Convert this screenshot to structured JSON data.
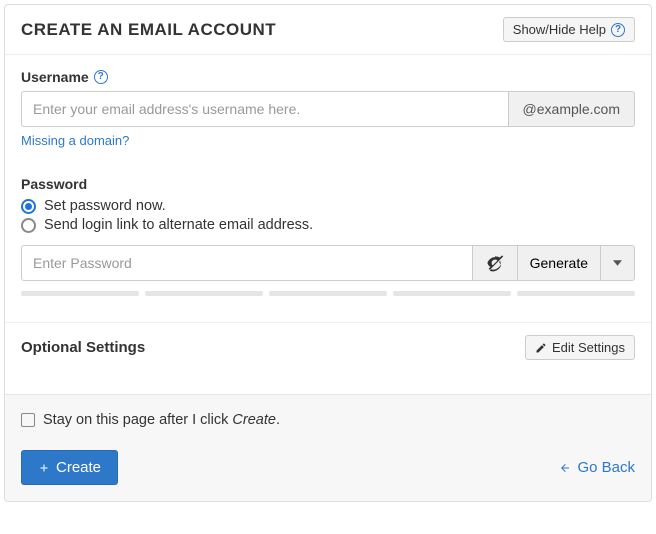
{
  "header": {
    "title": "CREATE AN EMAIL ACCOUNT",
    "help_button": "Show/Hide Help"
  },
  "username": {
    "label": "Username",
    "placeholder": "Enter your email address's username here.",
    "domain_suffix": "@example.com",
    "missing_domain_link": "Missing a domain?"
  },
  "password": {
    "label": "Password",
    "option_set_now": "Set password now.",
    "option_send_link": "Send login link to alternate email address.",
    "selected_option": "set_now",
    "placeholder": "Enter Password",
    "generate_label": "Generate"
  },
  "optional": {
    "title": "Optional Settings",
    "edit_button": "Edit Settings"
  },
  "footer": {
    "stay_prefix": "Stay on this page after I click ",
    "stay_emphasis": "Create",
    "stay_suffix": ".",
    "stay_checked": false,
    "create_button": "Create",
    "go_back": "Go Back"
  }
}
